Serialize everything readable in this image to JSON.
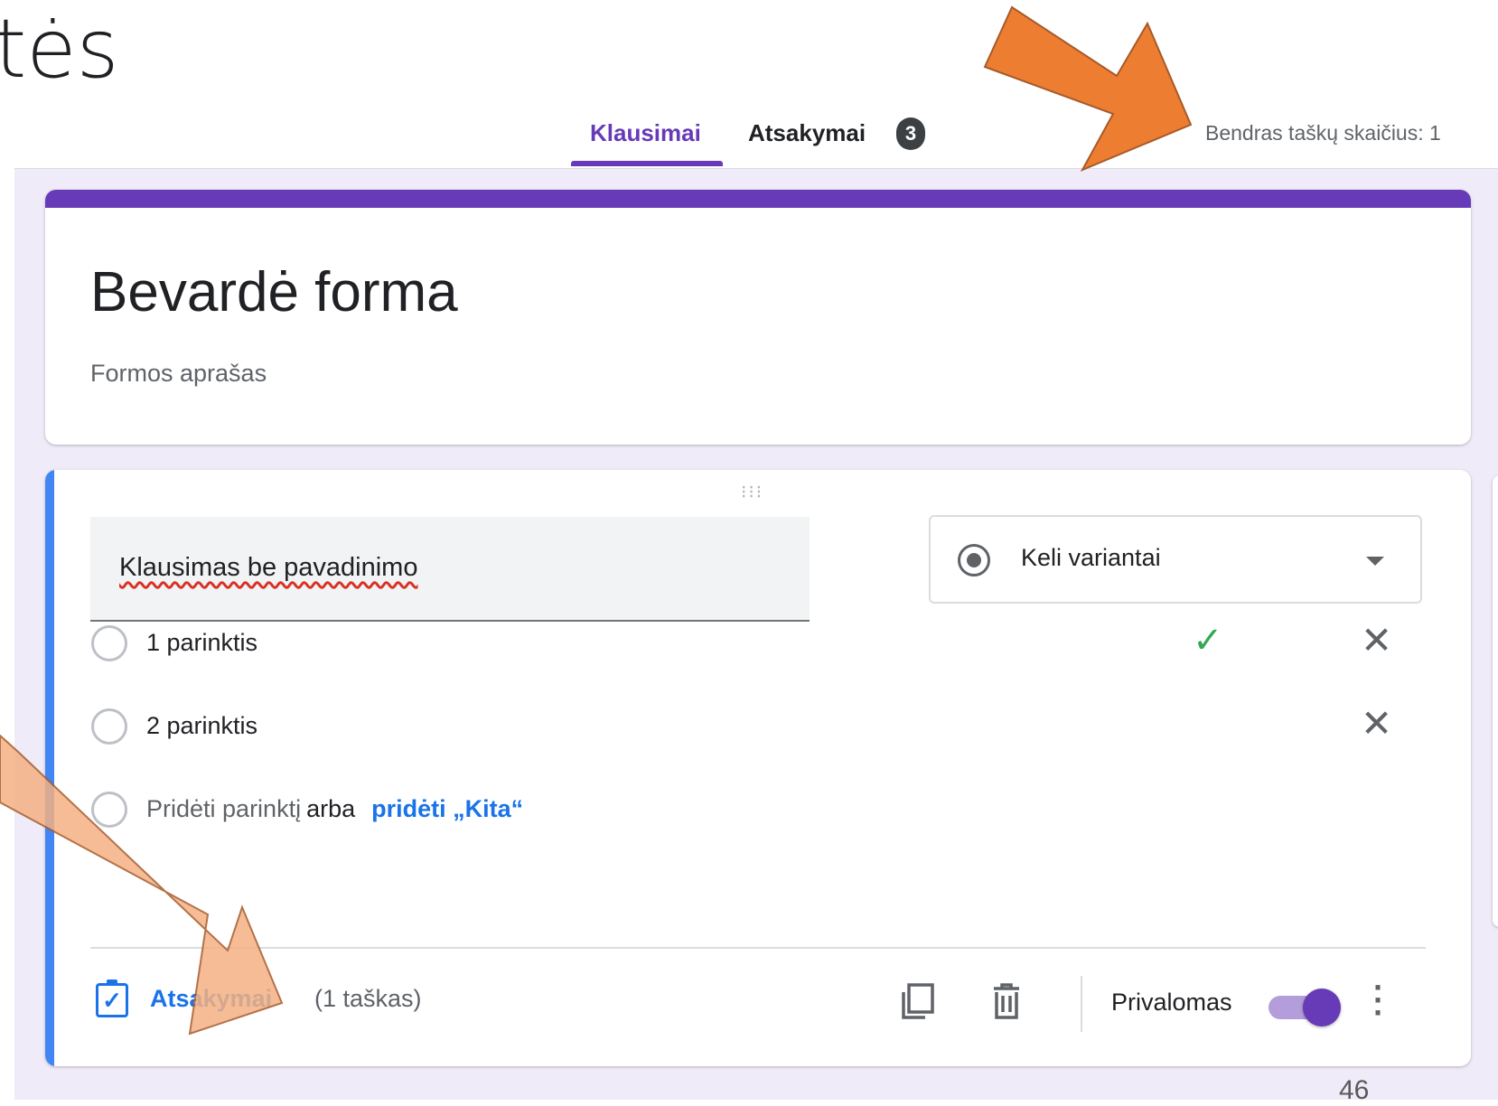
{
  "slide": {
    "title_fragment": "tės",
    "page_number": "46"
  },
  "tabs": [
    {
      "label": "Klausimai",
      "active": true
    },
    {
      "label": "Atsakymai",
      "badge": "3"
    }
  ],
  "total_points": "Bendras taškų skaičius: 1",
  "form": {
    "title": "Bevardė forma",
    "description": "Formos aprašas"
  },
  "question": {
    "title": "Klausimas be pavadinimo",
    "type": "Keli variantai",
    "options": [
      {
        "label": "1 parinktis",
        "correct": true
      },
      {
        "label": "2 parinktis",
        "correct": false
      }
    ],
    "add_option": "Pridėti parinktį",
    "add_or": "arba",
    "add_other": "pridėti „Kita“",
    "answers_link": "Atsakymai",
    "points": "(1 taškas)",
    "required_label": "Privalomas",
    "required": true
  },
  "icons": {
    "check": "check-icon",
    "remove": "close-icon",
    "duplicate": "copy-icon",
    "delete": "trash-icon",
    "more": "more-vert-icon",
    "answer_key": "clipboard-check-icon",
    "type_radio": "radio-button-icon",
    "dropdown": "caret-down-icon"
  },
  "colors": {
    "accent_purple": "#673ab7",
    "left_bar_blue": "#4285f4",
    "link_blue": "#1a73e8",
    "check_green": "#34a853",
    "annotation_arrow_dark": "#ed7d31",
    "annotation_arrow_light": "#f4b183",
    "form_background": "#f0ebf8"
  }
}
